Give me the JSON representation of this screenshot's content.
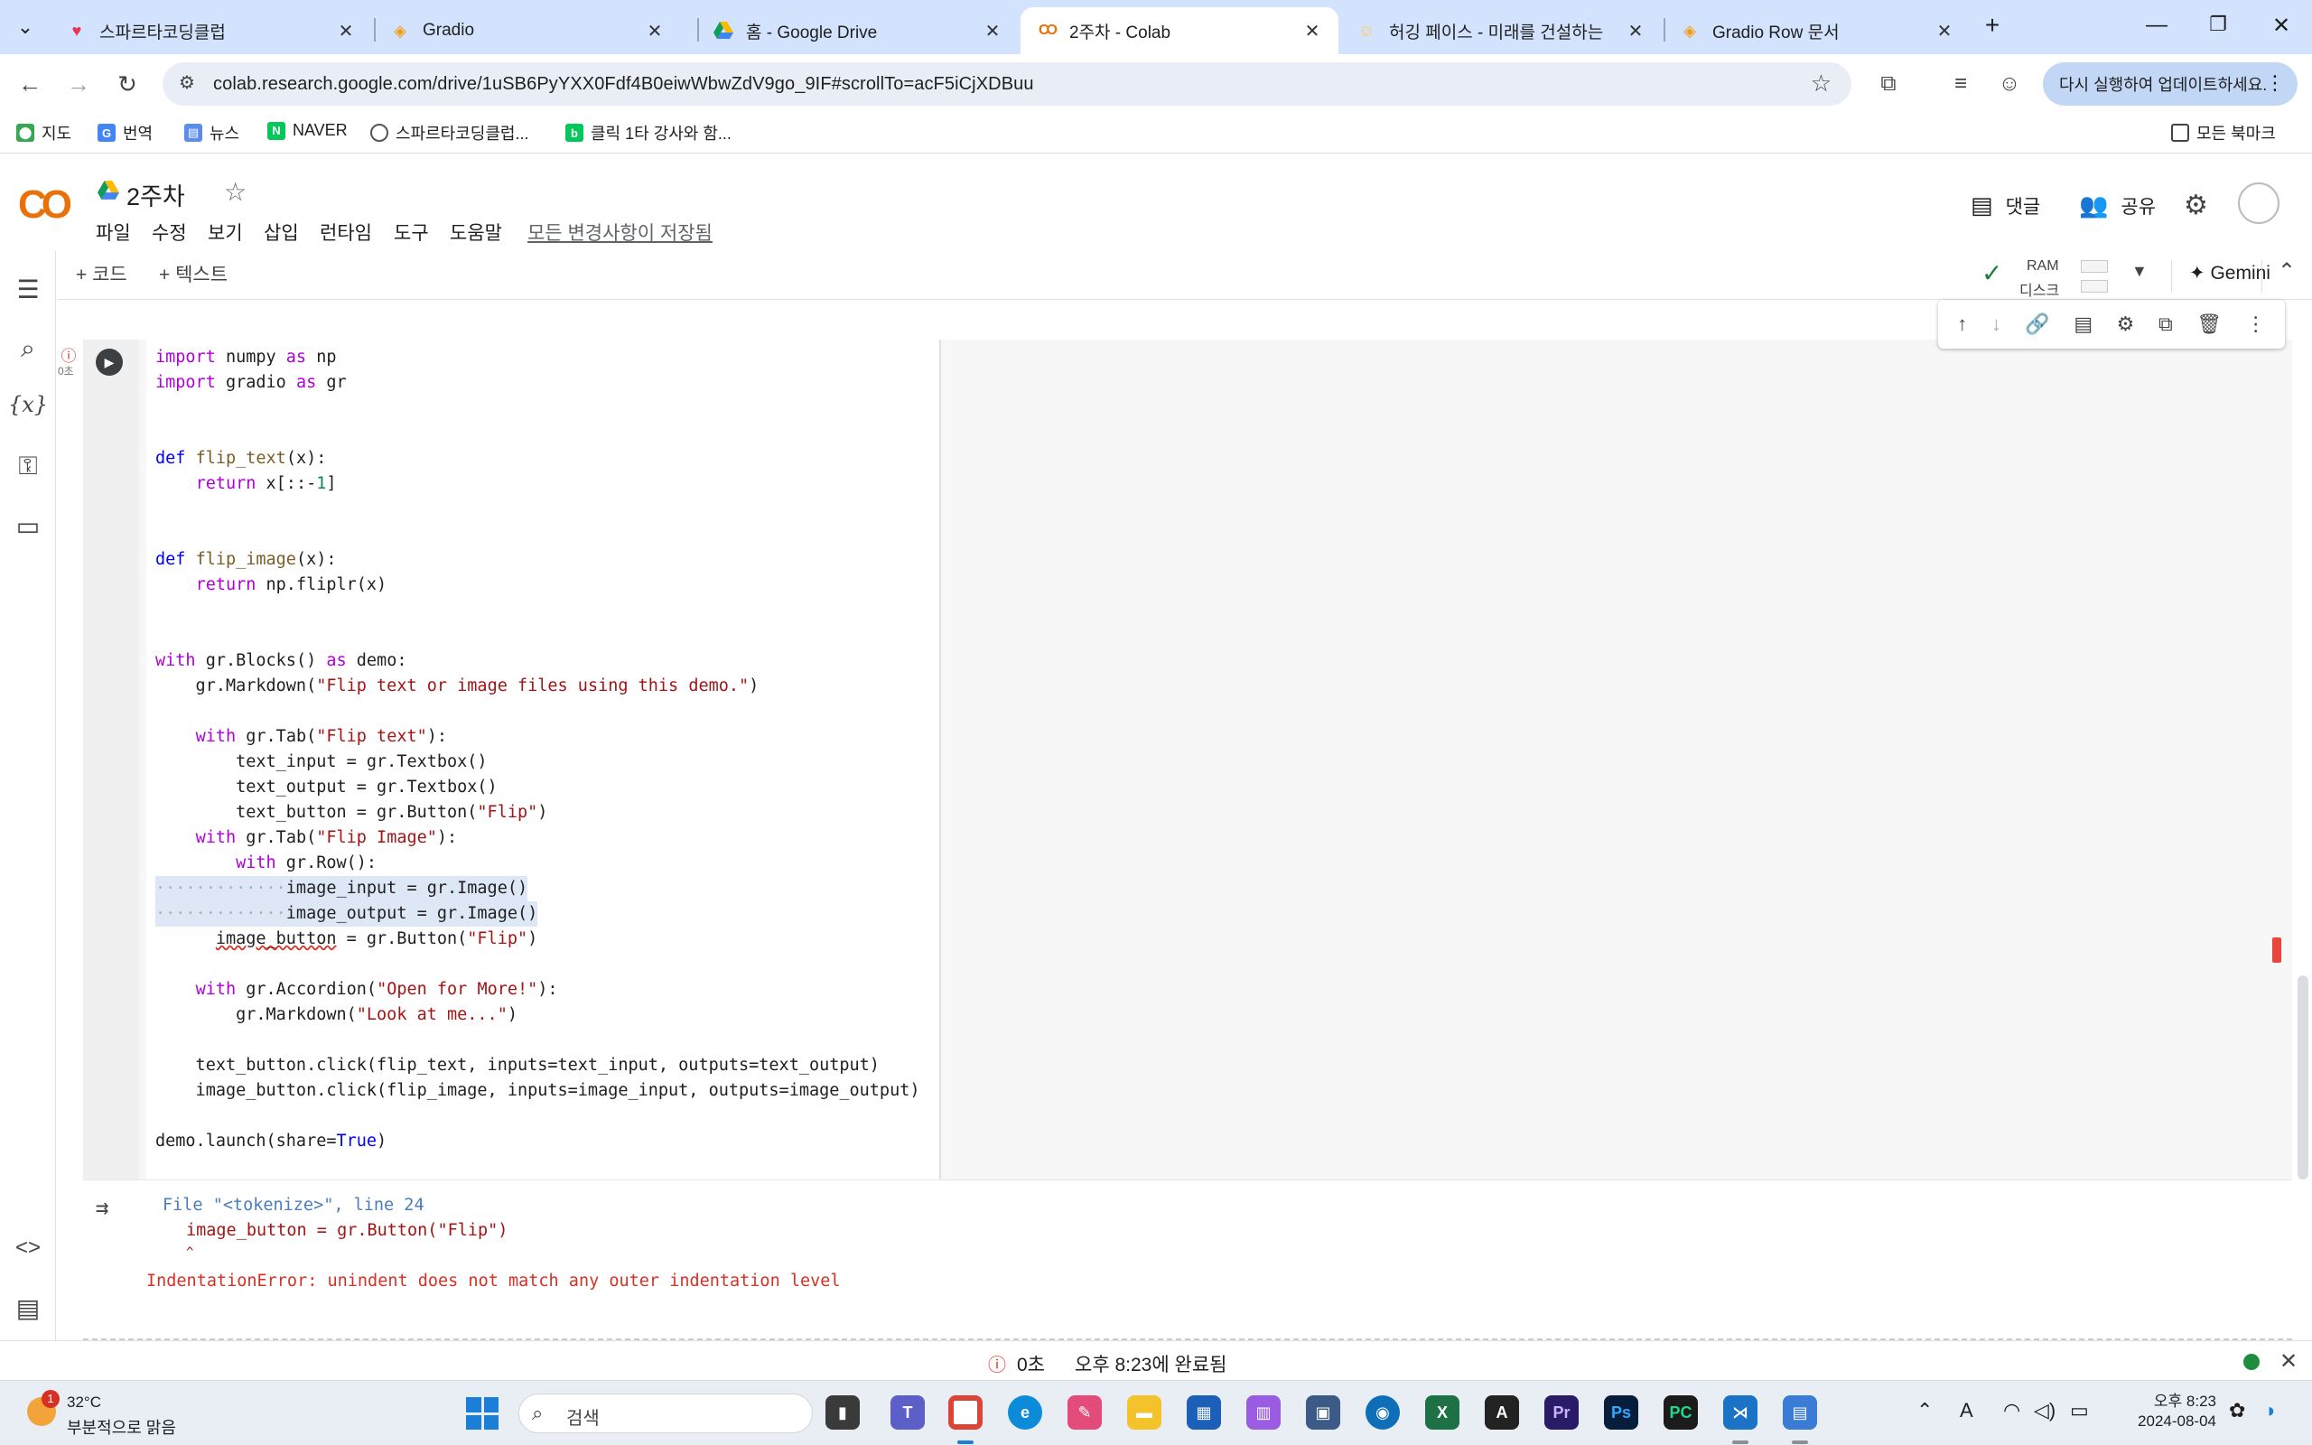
{
  "browser": {
    "tabs": [
      {
        "title": "스파르타코딩클럽",
        "icon": "sparta-favicon",
        "active": false
      },
      {
        "title": "Gradio",
        "icon": "gradio-favicon",
        "active": false
      },
      {
        "title": "홈 - Google Drive",
        "icon": "google-drive-favicon",
        "active": false
      },
      {
        "title": "2주차 - Colab",
        "icon": "colab-favicon",
        "active": true
      },
      {
        "title": "허깅 페이스 - 미래를 건설하는",
        "icon": "hugging-face-favicon",
        "active": false
      },
      {
        "title": "Gradio Row 문서",
        "icon": "gradio-favicon",
        "active": false
      }
    ],
    "url": "colab.research.google.com/drive/1uSB6PyYXX0Fdf4B0eiwWbwZdV9go_9IF#scrollTo=acF5iCjXDBuu",
    "update_button": "다시 실행하여 업데이트하세요.",
    "bookmarks": [
      "지도",
      "번역",
      "뉴스",
      "NAVER",
      "스파르타코딩클럽...",
      "클릭 1타 강사와 함..."
    ],
    "all_bookmarks": "모든 북마크"
  },
  "colab": {
    "logo": "CO",
    "notebook_title": "2주차",
    "menu": [
      "파일",
      "수정",
      "보기",
      "삽입",
      "런타임",
      "도구",
      "도움말"
    ],
    "saved_status": "모든 변경사항이 저장됨",
    "comment_label": "댓글",
    "share_label": "공유",
    "add_code": "+ 코드",
    "add_text": "+ 텍스트",
    "ram_label": "RAM",
    "disk_label": "디스크",
    "gemini_label": "Gemini"
  },
  "cell": {
    "exec_time": "0초",
    "code_lines": [
      "import numpy as np",
      "import gradio as gr",
      "",
      "",
      "def flip_text(x):",
      "    return x[::-1]",
      "",
      "",
      "def flip_image(x):",
      "    return np.fliplr(x)",
      "",
      "",
      "with gr.Blocks() as demo:",
      "    gr.Markdown(\"Flip text or image files using this demo.\")",
      "",
      "    with gr.Tab(\"Flip text\"):",
      "        text_input = gr.Textbox()",
      "        text_output = gr.Textbox()",
      "        text_button = gr.Button(\"Flip\")",
      "    with gr.Tab(\"Flip Image\"):",
      "        with gr.Row():",
      "            image_input = gr.Image()",
      "            image_output = gr.Image()",
      "      image_button = gr.Button(\"Flip\")",
      "",
      "    with gr.Accordion(\"Open for More!\"):",
      "        gr.Markdown(\"Look at me...\")",
      "",
      "    text_button.click(flip_text, inputs=text_input, outputs=text_output)",
      "    image_button.click(flip_image, inputs=image_input, outputs=image_output)",
      "",
      "demo.launch(share=True)"
    ],
    "output": {
      "file_line": "File \"<tokenize>\", line 24",
      "code_line": "image_button = gr.Button(\"Flip\")",
      "caret": "^",
      "error_type": "IndentationError:",
      "error_msg": "unindent does not match any outer indentation level"
    }
  },
  "statusbar": {
    "duration": "0초",
    "completed": "오후 8:23에 완료됨"
  },
  "taskbar": {
    "weather_temp": "32°C",
    "weather_cond": "부분적으로 맑음",
    "notif_count": "1",
    "search_placeholder": "검색",
    "time": "오후 8:23",
    "date": "2024-08-04"
  }
}
